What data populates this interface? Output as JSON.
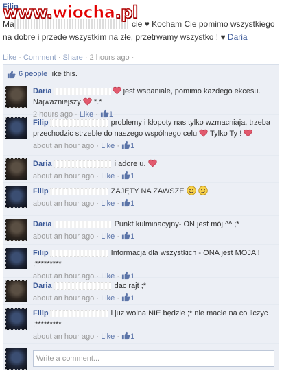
{
  "watermark": {
    "part1": "www.",
    "part2": "wiocha",
    "part3": ".pl"
  },
  "post": {
    "author": "Filip",
    "text_start": "Ma",
    "text_main": "cie ♥ Kocham Cie pomimo wszystkiego na dobre i przede wszystkim na złe, przetrwamy wszystko ! ♥ ",
    "tag": "Daria",
    "actions": {
      "like": "Like",
      "comment": "Comment",
      "share": "Share",
      "sep": " · ",
      "time": "2 hours ago",
      "sep2": " · "
    }
  },
  "likes": {
    "count_text": "6 people",
    "suffix": " like this."
  },
  "comments": [
    {
      "name": "Daria",
      "avatar": "daria",
      "text": "jest wspaniale, pomimo kazdego ekcesu. Najważniejszy",
      "tail": " *.*",
      "heart_mid": true,
      "time": "2 hours ago",
      "like": "Like",
      "likes": "1"
    },
    {
      "name": "Filip",
      "avatar": "filip",
      "text": "problemy i kłopoty nas tylko wzmacniaja, trzeba przechodzic strzeble do naszego wspólnego celu",
      "tail": " Tylko Ty !",
      "heart_mid": true,
      "time": "about an hour ago",
      "like": "Like",
      "likes": "1"
    },
    {
      "name": "Daria",
      "avatar": "daria",
      "text": "i adore u.",
      "tail": "",
      "heart_mid": true,
      "time": "about an hour ago",
      "like": "Like",
      "likes": "1"
    },
    {
      "name": "Filip",
      "avatar": "filip",
      "text": "ZAJĘTY NA ZAWSZE",
      "tail": "",
      "heart_mid": false,
      "time": "about an hour ago",
      "like": "Like",
      "likes": "1"
    },
    {
      "name": "Daria",
      "avatar": "daria",
      "text": "Punkt kulminacyjny- ON jest mój ^^ ;*",
      "tail": "",
      "heart_mid": false,
      "time": "about an hour ago",
      "like": "Like",
      "likes": "1"
    },
    {
      "name": "Filip",
      "avatar": "filip",
      "text": "Informacja dla wszystkich - ONA jest MOJA ! ;*********",
      "tail": "",
      "heart_mid": false,
      "time": "about an hour ago",
      "like": "Like",
      "likes": "1"
    },
    {
      "name": "Daria",
      "avatar": "daria",
      "text": "dac rajt ;*",
      "tail": "",
      "heart_mid": false,
      "time": "about an hour ago",
      "like": "Like",
      "likes": "1"
    },
    {
      "name": "Filip",
      "avatar": "filip",
      "text": "i juz wolna NIE będzie ;* nie macie na co liczyc ;*********",
      "tail": "",
      "heart_mid": false,
      "time": "about an hour ago",
      "like": "Like",
      "likes": "1"
    }
  ],
  "write_placeholder": "Write a comment...",
  "colors": {
    "link": "#3b5998",
    "feedback_bg": "#eceff5",
    "heart": "#e25a6e"
  }
}
